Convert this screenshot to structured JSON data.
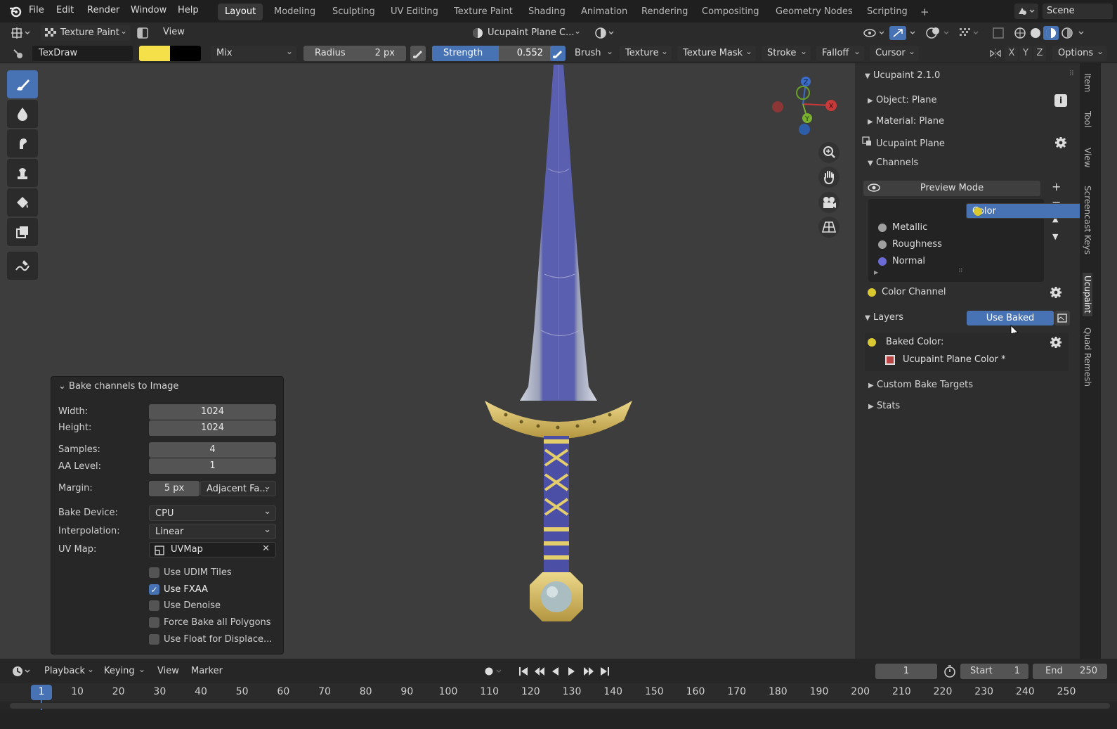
{
  "menubar": {
    "items": [
      "File",
      "Edit",
      "Render",
      "Window",
      "Help"
    ],
    "workspaces": [
      "Layout",
      "Modeling",
      "Sculpting",
      "UV Editing",
      "Texture Paint",
      "Shading",
      "Animation",
      "Rendering",
      "Compositing",
      "Geometry Nodes",
      "Scripting"
    ],
    "active_workspace": "Layout",
    "add_workspace": "+",
    "scene": "Scene"
  },
  "header": {
    "mode": "Texture Paint",
    "view": "View",
    "object": "Ucupaint Plane C...",
    "brush_name": "TexDraw",
    "primary_color": "#f5e04a",
    "secondary_color": "#000000",
    "blend": "Mix",
    "radius_label": "Radius",
    "radius_value": "2 px",
    "strength_label": "Strength",
    "strength_value": "0.552",
    "menus": [
      "Brush",
      "Texture",
      "Texture Mask",
      "Stroke",
      "Falloff",
      "Cursor"
    ],
    "axes": [
      "X",
      "Y",
      "Z"
    ],
    "options": "Options"
  },
  "gizmo": {
    "z": "Z",
    "x": "X",
    "y": "Y"
  },
  "npanel": {
    "title": "Ucupaint 2.1.0",
    "object": "Object: Plane",
    "material": "Material: Plane",
    "ucupaint": "Ucupaint Plane",
    "channels_label": "Channels",
    "preview_mode": "Preview Mode",
    "channels": [
      {
        "name": "Color",
        "color": "#d9c830",
        "selected": true
      },
      {
        "name": "Metallic",
        "color": "#a0a0a0",
        "selected": false
      },
      {
        "name": "Roughness",
        "color": "#a0a0a0",
        "selected": false
      },
      {
        "name": "Normal",
        "color": "#6b6bd6",
        "selected": false
      }
    ],
    "color_channel": "Color Channel",
    "layers_label": "Layers",
    "use_baked": "Use Baked",
    "baked_color": "Baked Color:",
    "baked_image": "Ucupaint Plane Color *",
    "custom_bake_targets": "Custom Bake Targets",
    "stats": "Stats",
    "vertical_tabs": [
      "Item",
      "Tool",
      "View",
      "Screencast Keys",
      "Ucupaint",
      "Quad Remesh"
    ]
  },
  "bake_dialog": {
    "title": "Bake channels to Image",
    "width_label": "Width:",
    "width_value": "1024",
    "height_label": "Height:",
    "height_value": "1024",
    "samples_label": "Samples:",
    "samples_value": "4",
    "aa_label": "AA Level:",
    "aa_value": "1",
    "margin_label": "Margin:",
    "margin_value": "5 px",
    "margin_type": "Adjacent Fa...",
    "device_label": "Bake Device:",
    "device_value": "CPU",
    "interp_label": "Interpolation:",
    "interp_value": "Linear",
    "uvmap_label": "UV Map:",
    "uvmap_value": "UVMap",
    "checkboxes": [
      {
        "label": "Use UDIM Tiles",
        "checked": false
      },
      {
        "label": "Use FXAA",
        "checked": true
      },
      {
        "label": "Use Denoise",
        "checked": false
      },
      {
        "label": "Force Bake all Polygons",
        "checked": false
      },
      {
        "label": "Use Float for Displace...",
        "checked": false
      }
    ]
  },
  "timeline": {
    "menus": [
      "Playback",
      "Keying",
      "View",
      "Marker"
    ],
    "current_frame": "1",
    "start_label": "Start",
    "start_value": "1",
    "end_label": "End",
    "end_value": "250",
    "ruler": [
      "1",
      "10",
      "20",
      "30",
      "40",
      "50",
      "60",
      "70",
      "80",
      "90",
      "100",
      "110",
      "120",
      "130",
      "140",
      "150",
      "160",
      "170",
      "180",
      "190",
      "200",
      "210",
      "220",
      "230",
      "240",
      "250"
    ]
  }
}
